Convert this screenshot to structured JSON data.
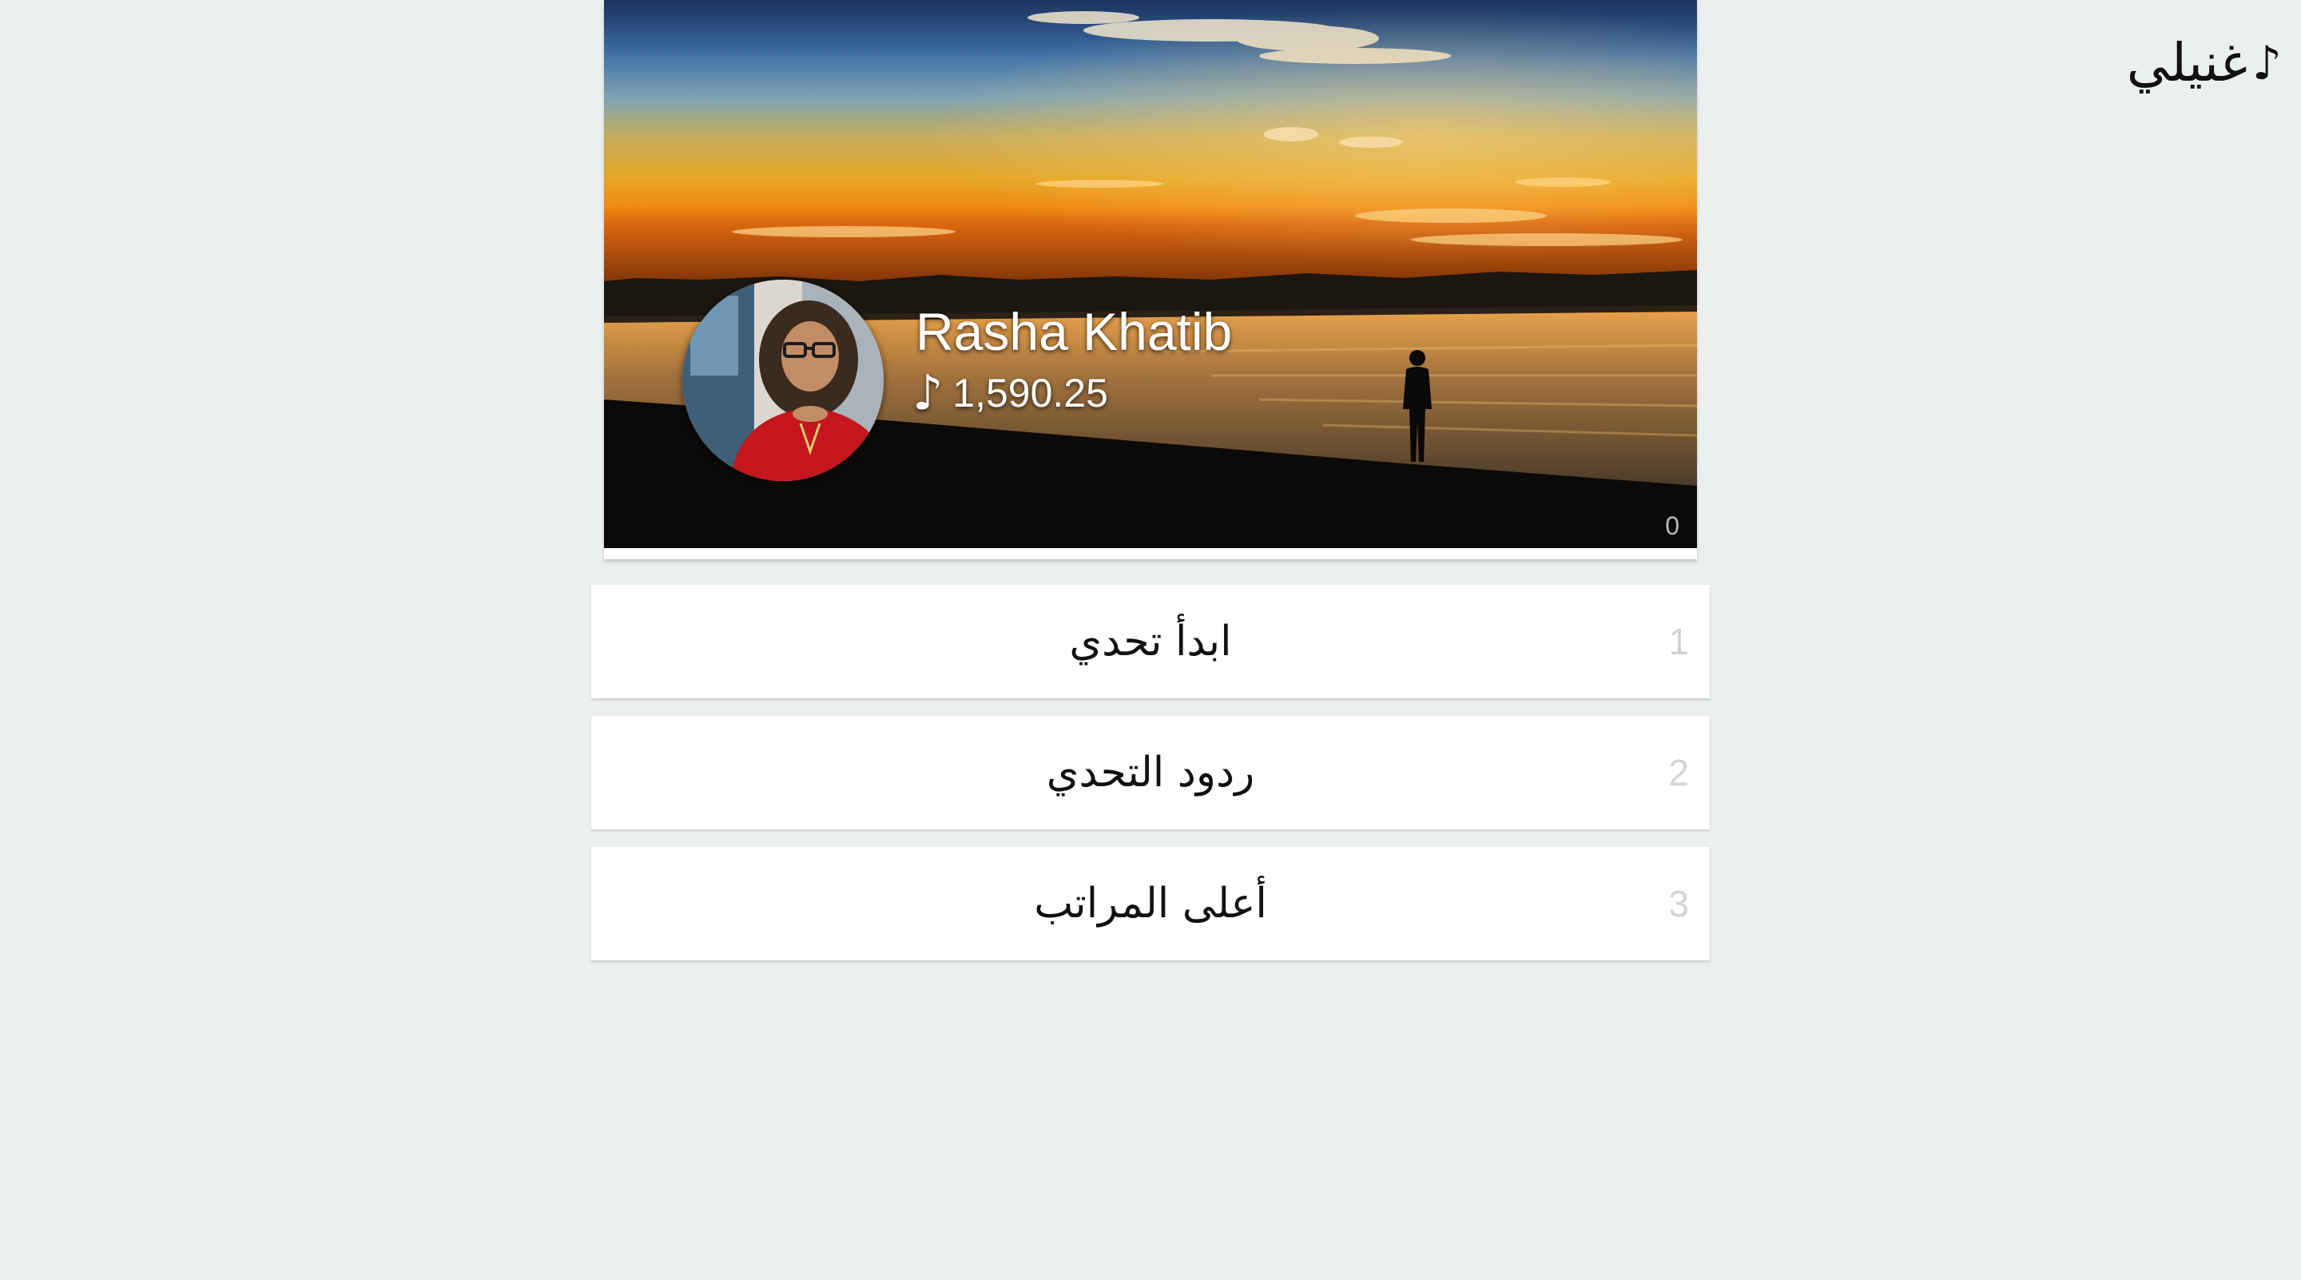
{
  "app": {
    "title": "غنيلي",
    "title_icon": "music-note-icon",
    "title_icon_glyph": "♪"
  },
  "profile": {
    "name": "Rasha Khatib",
    "balance": "1,590.25",
    "balance_icon": "music-note-icon",
    "balance_icon_glyph": "♪",
    "cover_counter": "0",
    "cover_image": "sunset-lake-photo",
    "avatar_image": "user-avatar-photo"
  },
  "menu": {
    "items": [
      {
        "index": "1",
        "label": "ابدأ تحدي"
      },
      {
        "index": "2",
        "label": "ردود التحدي"
      },
      {
        "index": "3",
        "label": "أعلى المراتب"
      }
    ]
  },
  "colors": {
    "page_background": "#eceff0",
    "card_background": "#ffffff",
    "index_text": "#d4d4d4"
  }
}
